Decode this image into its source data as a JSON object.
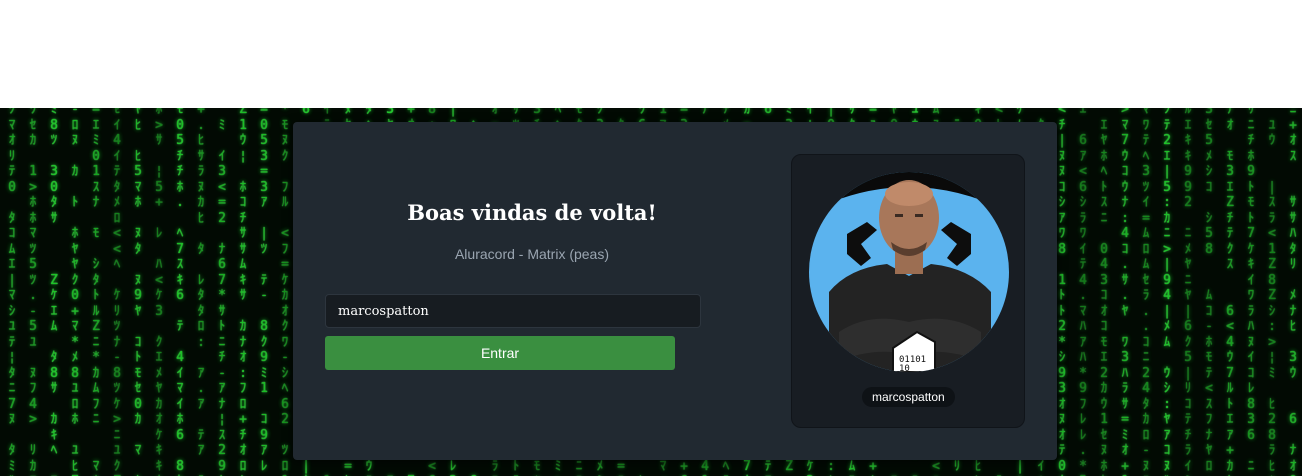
{
  "login": {
    "title": "Boas vindas de volta!",
    "subtitle": "Aluracord - Matrix (peas)",
    "username_value": "marcospatton",
    "submit_label": "Entrar"
  },
  "profile": {
    "username": "marcospatton",
    "avatar_icon": "user-avatar-photo"
  },
  "theme": {
    "matrix_green": "#1fd22a",
    "card_background": "#212931",
    "button_green": "#3a8f40"
  }
}
